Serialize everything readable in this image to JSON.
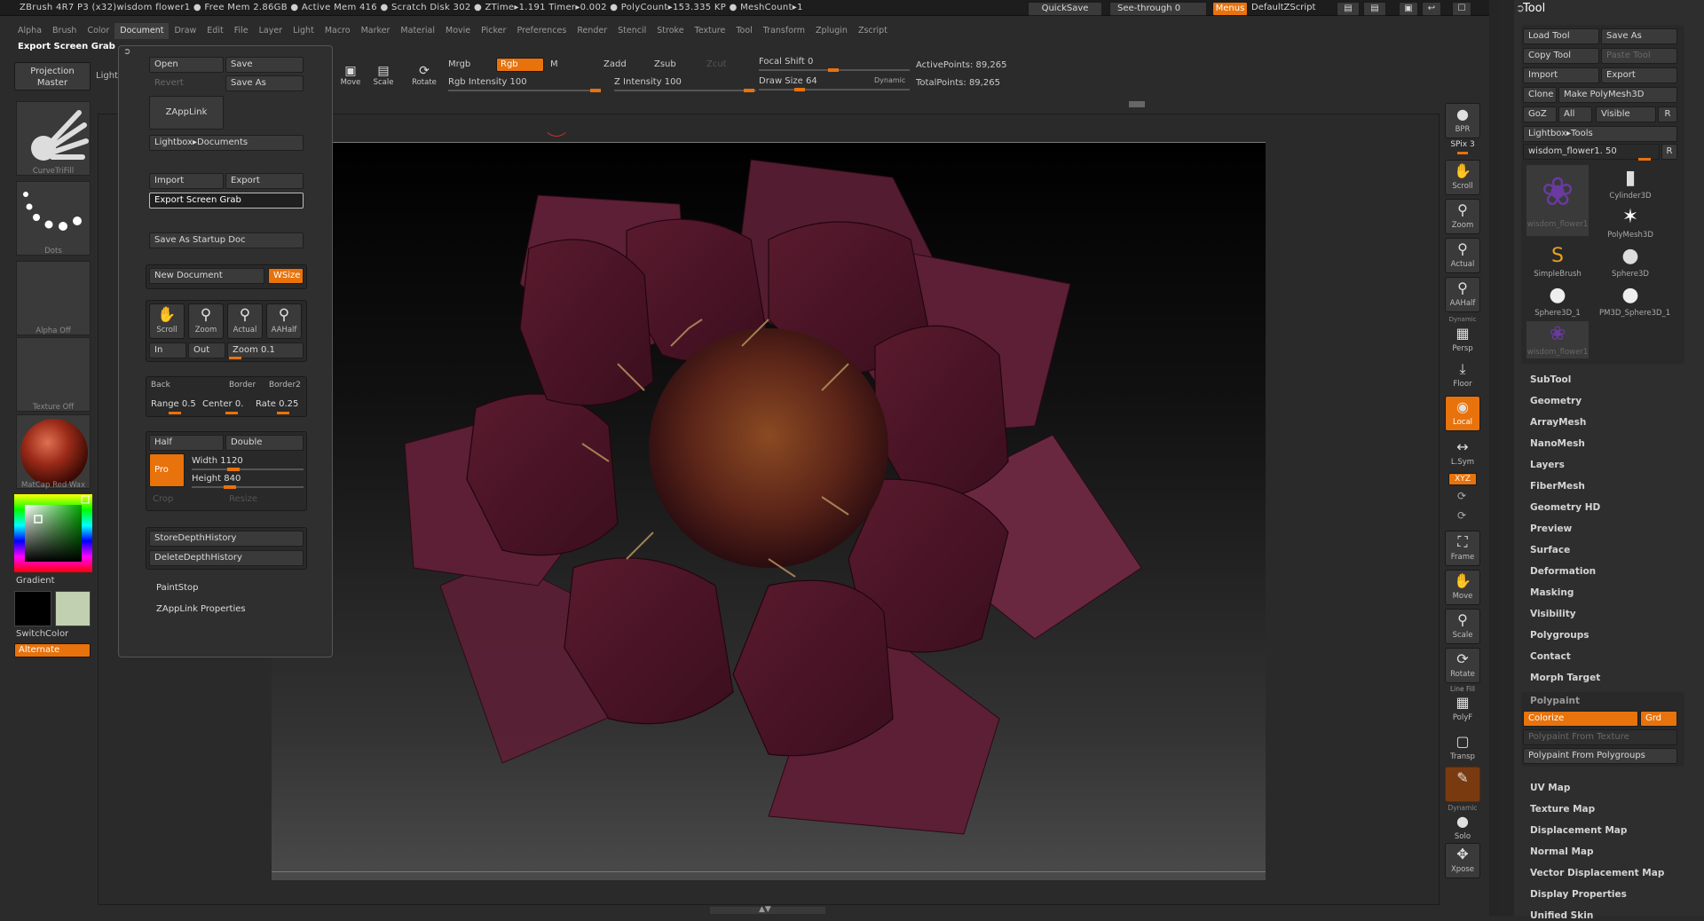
{
  "title_bar": {
    "text": "ZBrush 4R7 P3 (x32)wisdom flower1   ● Free Mem 2.86GB ● Active Mem 416 ● Scratch Disk 302 ● ZTime▸1.191 Timer▸0.002 ● PolyCount▸153.335 KP  ● MeshCount▸1",
    "quicksave": "QuickSave",
    "seethrough": "See-through  0",
    "menus": "Menus",
    "script": "DefaultZScript"
  },
  "menu_items": [
    "Alpha",
    "Brush",
    "Color",
    "Document",
    "Draw",
    "Edit",
    "File",
    "Layer",
    "Light",
    "Macro",
    "Marker",
    "Material",
    "Movie",
    "Picker",
    "Preferences",
    "Render",
    "Stencil",
    "Stroke",
    "Texture",
    "Tool",
    "Transform",
    "Zplugin",
    "Zscript"
  ],
  "active_menu": "Document",
  "palette_title": "Export Screen Grab",
  "top_toolbar": {
    "projection_master": "Projection Master",
    "lightbox": "LightBox",
    "move": "Move",
    "scale": "Scale",
    "rotate": "Rotate",
    "mrgb": "Mrgb",
    "rgb": "Rgb",
    "m": "M",
    "rgb_intensity": "Rgb Intensity 100",
    "zadd": "Zadd",
    "zsub": "Zsub",
    "zcut": "Zcut",
    "z_intensity": "Z Intensity 100",
    "focal_shift": "Focal Shift 0",
    "draw_size": "Draw Size 64",
    "dynamic": "Dynamic",
    "active_points": "ActivePoints: 89,265",
    "total_points": "TotalPoints: 89,265"
  },
  "left_shelf": {
    "brush_label": "CurveTriFill",
    "stroke_label": "Dots",
    "alpha_label": "Alpha Off",
    "texture_label": "Texture Off",
    "material_label": "MatCap Red Wax",
    "gradient": "Gradient",
    "switch_color": "SwitchColor",
    "alternate": "Alternate"
  },
  "document_menu": {
    "open": "Open",
    "save": "Save",
    "revert": "Revert",
    "save_as": "Save As",
    "zapplink": "ZAppLink",
    "lightbox_docs": "Lightbox▸Documents",
    "import": "Import",
    "export": "Export",
    "export_screen_grab": "Export Screen Grab",
    "save_startup": "Save As Startup Doc",
    "new_document": "New Document",
    "wsize": "WSize",
    "scroll": "Scroll",
    "zoom": "Zoom",
    "actual": "Actual",
    "aahalf": "AAHalf",
    "in": "In",
    "out": "Out",
    "zoom_val": "Zoom 0.1",
    "back": "Back",
    "border": "Border",
    "border2": "Border2",
    "range": "Range 0.5",
    "center": "Center 0.",
    "rate": "Rate 0.25",
    "half": "Half",
    "double": "Double",
    "pro": "Pro",
    "width": "Width 1120",
    "height": "Height 840",
    "crop": "Crop",
    "resize": "Resize",
    "store_depth": "StoreDepthHistory",
    "delete_depth": "DeleteDepthHistory",
    "paintstop": "PaintStop",
    "zapplink_props": "ZAppLink Properties"
  },
  "right_dock": {
    "bpr": "BPR",
    "spix": "SPix 3",
    "scroll": "Scroll",
    "zoom": "Zoom",
    "actual": "Actual",
    "aahalf": "AAHalf",
    "dynamic": "Dynamic",
    "persp": "Persp",
    "floor": "Floor",
    "local": "Local",
    "lsym": "L.Sym",
    "xyz": "XYZ",
    "frame": "Frame",
    "move": "Move",
    "scale": "Scale",
    "rotate": "Rotate",
    "linefill": "Line Fill",
    "polyf": "PolyF",
    "transp": "Transp",
    "ghost": "Dynamic",
    "solo": "Solo",
    "xpose": "Xpose"
  },
  "tool_panel": {
    "title": "Tool",
    "load_tool": "Load Tool",
    "save_as": "Save As",
    "copy_tool": "Copy Tool",
    "paste_tool": "Paste Tool",
    "import": "Import",
    "export": "Export",
    "clone": "Clone",
    "make_polymesh": "Make PolyMesh3D",
    "goz": "GoZ",
    "all": "All",
    "visible": "Visible",
    "r": "R",
    "lightbox_tools": "Lightbox▸Tools",
    "current_tool": "wisdom_flower1. 50",
    "items": [
      {
        "label": "wisdom_flower1"
      },
      {
        "label": "Cylinder3D"
      },
      {
        "label": "PolyMesh3D"
      },
      {
        "label": "SimpleBrush"
      },
      {
        "label": "Sphere3D"
      },
      {
        "label": "Sphere3D_1"
      },
      {
        "label": "PM3D_Sphere3D_1"
      },
      {
        "label": "wisdom_flower1"
      }
    ],
    "sections": [
      "SubTool",
      "Geometry",
      "ArrayMesh",
      "NanoMesh",
      "Layers",
      "FiberMesh",
      "Geometry HD",
      "Preview",
      "Surface",
      "Deformation",
      "Masking",
      "Visibility",
      "Polygroups",
      "Contact",
      "Morph Target"
    ],
    "polypaint": "Polypaint",
    "colorize": "Colorize",
    "grd": "Grd",
    "pp_texture": "Polypaint From Texture",
    "pp_polygroups": "Polypaint From Polygroups",
    "sections2": [
      "UV Map",
      "Texture Map",
      "Displacement Map",
      "Normal Map",
      "Vector Displacement Map",
      "Display Properties",
      "Unified Skin"
    ]
  },
  "colors": {
    "accent": "#e8720c",
    "petal": "#4a1424",
    "center": "#6e2e1a"
  }
}
